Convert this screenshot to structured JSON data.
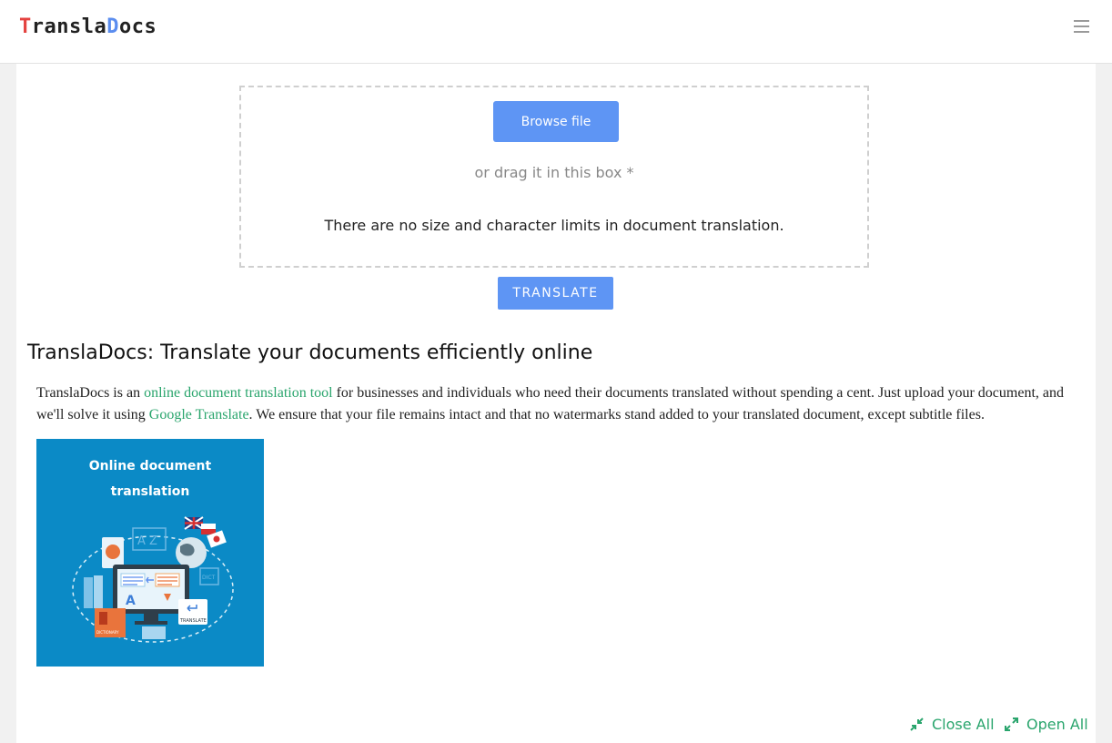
{
  "header": {
    "logo": {
      "first_letter": "T",
      "part_a": "ransla",
      "d_letter": "D",
      "part_b": "ocs"
    },
    "menu_icon": "hamburger-menu-icon"
  },
  "upload": {
    "browse_label": "Browse file",
    "drag_text": "or drag it in this box *",
    "limits_text": "There are no size and character limits in document translation."
  },
  "translate_label": "TRANSLATE",
  "article": {
    "title": "TranslaDocs: Translate your documents efficiently online",
    "intro_a": "TranslaDocs is an ",
    "link_tool": "online document translation tool",
    "intro_b": " for businesses and individuals who need their documents translated without spending a cent. Just upload your document, and we'll solve it using ",
    "link_google": "Google Translate",
    "intro_c": ". We ensure that your file remains intact and that no watermarks stand added to your translated document, except subtitle files.",
    "hero": {
      "line1": "Online document",
      "line2": "translation",
      "az": "A Z",
      "a": "A",
      "dict": "DICT",
      "translate_badge": "TRANSLATE",
      "dictionary": "DICTIONARY"
    }
  },
  "footer": {
    "close_all": "Close All",
    "open_all": "Open All",
    "close_icon": "compress-arrows-icon",
    "open_icon": "expand-arrows-icon"
  },
  "colors": {
    "accent_blue": "#5e95f4",
    "link_green": "#2aa56d",
    "logo_red": "#e4423f",
    "logo_blue": "#5b8def",
    "hero_bg": "#0b8ac6"
  }
}
